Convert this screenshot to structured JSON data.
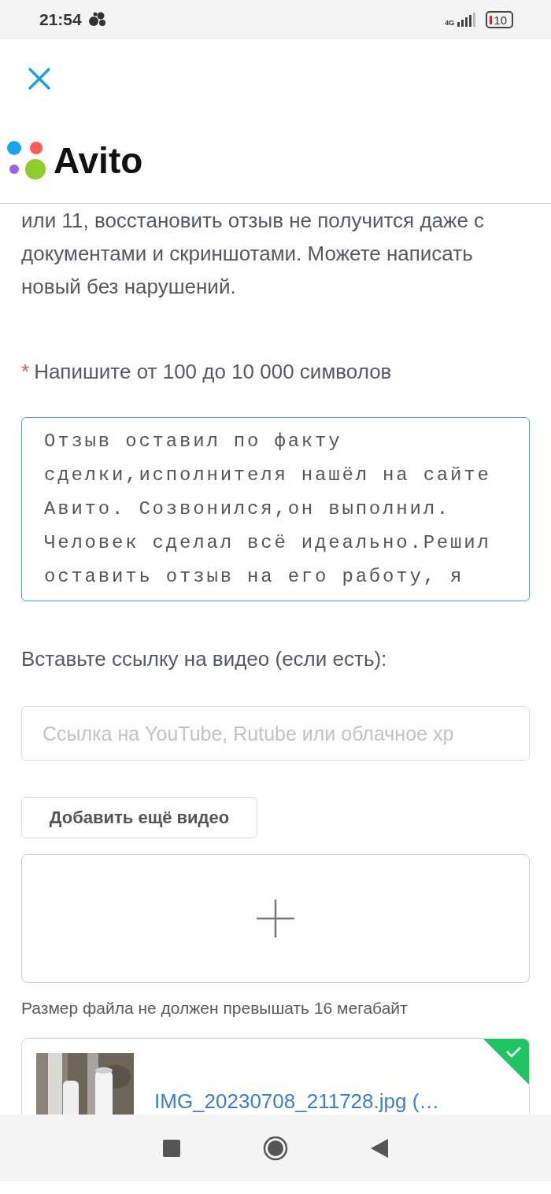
{
  "status_bar": {
    "time": "21:54",
    "network": "4G",
    "battery": "10"
  },
  "logo": {
    "text": "Avito"
  },
  "notice": "или 11, восстановить отзыв не получится даже с документами и скриншотами. Можете написать новый без нарушений.",
  "review": {
    "required_mark": "*",
    "label": "Напишите от 100 до 10 000 символов",
    "value": "Отзыв оставил по факту сделки,исполнителя нашёл на сайте Авито. Созвонился,он выполнил. Человек сделал всё идеально.Решил оставить отзыв на его работу, я"
  },
  "video": {
    "label": "Вставьте ссылку на видео (если есть):",
    "placeholder": "Ссылка на YouTube, Rutube или облачное хр",
    "add_button": "Добавить ещё видео"
  },
  "upload": {
    "hint": "Размер файла не должен превышать 16 мегабайт"
  },
  "files": [
    {
      "kind": "picture",
      "name": "IMG_20230708_211728.jpg (…",
      "uploaded": true
    }
  ]
}
